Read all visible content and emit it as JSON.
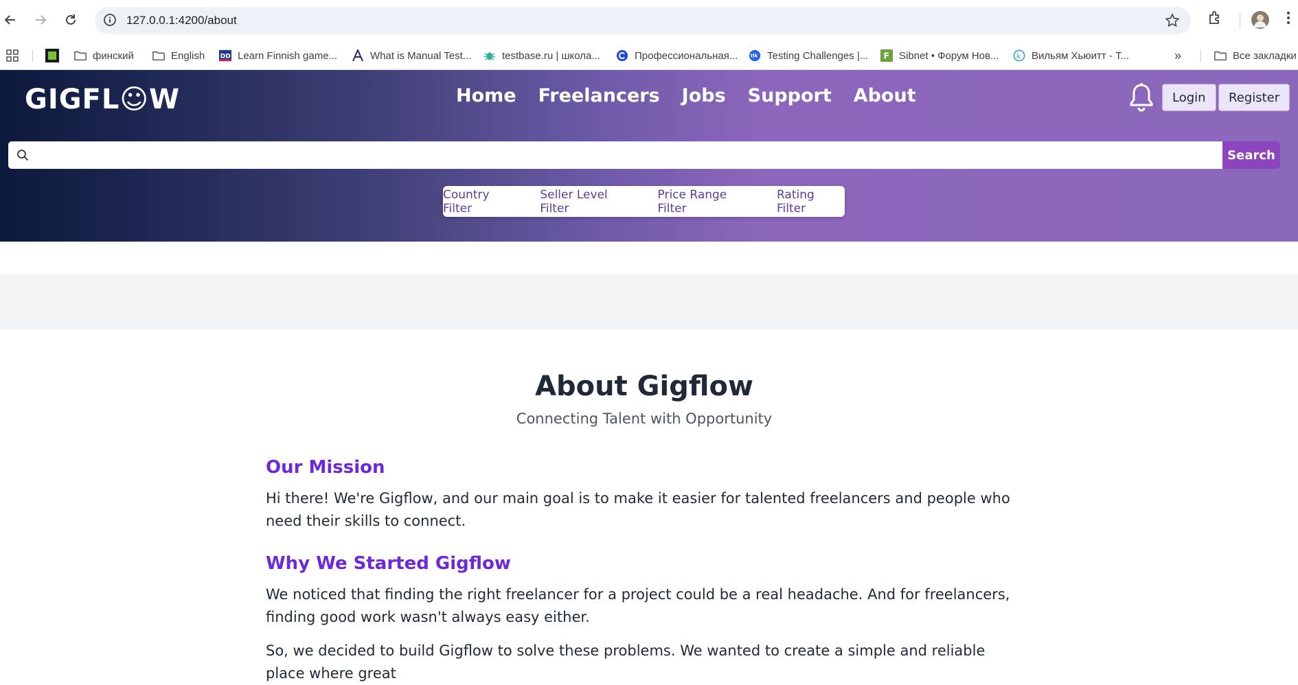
{
  "browser": {
    "url": "127.0.0.1:4200/about",
    "bookmarks": [
      {
        "label": "финский",
        "icon": "folder-icon"
      },
      {
        "label": "English",
        "icon": "folder-icon"
      },
      {
        "label": "Learn Finnish game...",
        "icon": "dd-icon"
      },
      {
        "label": "What is Manual Test...",
        "icon": "a-icon"
      },
      {
        "label": "testbase.ru | школа...",
        "icon": "bug-icon"
      },
      {
        "label": "Профессиональная...",
        "icon": "c-icon"
      },
      {
        "label": "Testing Challenges |...",
        "icon": "tlk-icon"
      },
      {
        "label": "Sibnet • Форум Нов...",
        "icon": "f-icon"
      },
      {
        "label": "Вильям Хьюитт - Т...",
        "icon": "k-icon"
      }
    ],
    "all_bookmarks": "Все закладки"
  },
  "header": {
    "logo": "GIGFL☺W",
    "nav": [
      "Home",
      "Freelancers",
      "Jobs",
      "Support",
      "About"
    ],
    "login": "Login",
    "register": "Register",
    "search_button": "Search",
    "search_placeholder": "",
    "filters": [
      "Country Filter",
      "Seller Level Filter",
      "Price Range Filter",
      "Rating Filter"
    ]
  },
  "about": {
    "title": "About Gigflow",
    "subtitle": "Connecting Talent with Opportunity",
    "mission_heading": "Our Mission",
    "mission_text": "Hi there! We're Gigflow, and our main goal is to make it easier for talented freelancers and people who need their skills to connect.",
    "why_heading": "Why We Started Gigflow",
    "why_text": "We noticed that finding the right freelancer for a project could be a real headache. And for freelancers, finding good work wasn't always easy either.",
    "why_text2": "So, we decided to build Gigflow to solve these problems. We wanted to create a simple and reliable place where great"
  }
}
